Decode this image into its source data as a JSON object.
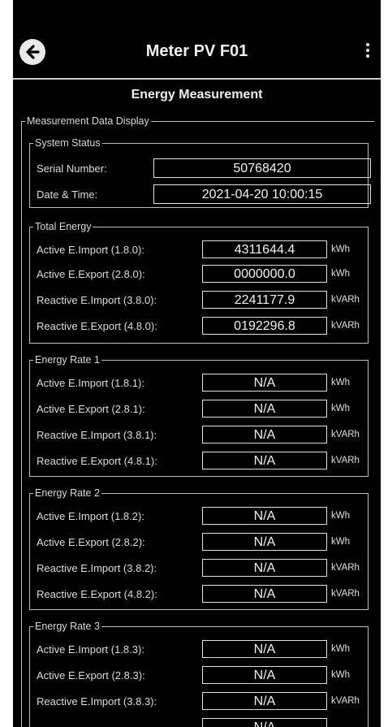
{
  "appbar": {
    "title": "Meter PV F01"
  },
  "subtitle": "Energy Measurement",
  "section": "Measurement Data Display",
  "system_status": {
    "legend": "System Status",
    "rows": [
      {
        "label": "Serial Number:",
        "value": "50768420"
      },
      {
        "label": "Date & Time:",
        "value": "2021-04-20 10:00:15"
      }
    ]
  },
  "groups": [
    {
      "legend": "Total Energy",
      "rows": [
        {
          "label": "Active E.Import (1.8.0):",
          "value": "4311644.4",
          "unit": "kWh"
        },
        {
          "label": "Active E.Export (2.8.0):",
          "value": "0000000.0",
          "unit": "kWh"
        },
        {
          "label": "Reactive E.Import (3.8.0):",
          "value": "2241177.9",
          "unit": "kVARh"
        },
        {
          "label": "Reactive E.Export (4.8.0):",
          "value": "0192296.8",
          "unit": "kVARh"
        }
      ]
    },
    {
      "legend": "Energy Rate 1",
      "rows": [
        {
          "label": "Active E.Import (1.8.1):",
          "value": "N/A",
          "unit": "kWh"
        },
        {
          "label": "Active E.Export (2.8.1):",
          "value": "N/A",
          "unit": "kWh"
        },
        {
          "label": "Reactive E.Import (3.8.1):",
          "value": "N/A",
          "unit": "kVARh"
        },
        {
          "label": "Reactive E.Export (4.8.1):",
          "value": "N/A",
          "unit": "kVARh"
        }
      ]
    },
    {
      "legend": "Energy Rate 2",
      "rows": [
        {
          "label": "Active E.Import (1.8.2):",
          "value": "N/A",
          "unit": "kWh"
        },
        {
          "label": "Active E.Export (2.8.2):",
          "value": "N/A",
          "unit": "kWh"
        },
        {
          "label": "Reactive E.Import (3.8.2):",
          "value": "N/A",
          "unit": "kVARh"
        },
        {
          "label": "Reactive E.Export (4.8.2):",
          "value": "N/A",
          "unit": "kVARh"
        }
      ]
    },
    {
      "legend": "Energy Rate 3",
      "rows": [
        {
          "label": "Active E.Import (1.8.3):",
          "value": "N/A",
          "unit": "kWh"
        },
        {
          "label": "Active E.Export (2.8.3):",
          "value": "N/A",
          "unit": "kWh"
        },
        {
          "label": "Reactive E.Import (3.8.3):",
          "value": "N/A",
          "unit": "kVARh"
        },
        {
          "label": "",
          "value": "N/A",
          "unit": ""
        }
      ]
    }
  ],
  "icons": {
    "back": "back-arrow-icon",
    "menu": "more-vert-icon"
  },
  "colors": {
    "background": "#000000",
    "text": "#e8e8e8",
    "border": "#bdbdbd"
  }
}
